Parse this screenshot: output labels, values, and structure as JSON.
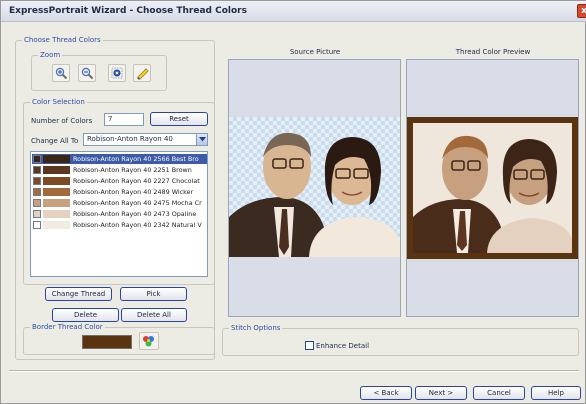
{
  "window": {
    "title": "ExpressPortrait Wizard - Choose Thread Colors",
    "close_glyph": "x"
  },
  "choose_group": {
    "label": "Choose Thread Colors"
  },
  "zoom": {
    "label": "Zoom",
    "buttons": [
      "zoom-in-icon",
      "zoom-out-icon",
      "zoom-fit-icon",
      "highlight-pen-icon"
    ]
  },
  "color_selection": {
    "label": "Color Selection",
    "number_of_colors_label": "Number of Colors",
    "number_of_colors_value": "7",
    "reset_label": "Reset",
    "change_all_label": "Change All To",
    "change_all_value": "Robison-Anton Rayon 40",
    "threads": [
      {
        "name": "Robison-Anton Rayon 40 2566 Best Bro",
        "color": "#3c2417"
      },
      {
        "name": "Robison-Anton Rayon 40 2251 Brown",
        "color": "#5c3620"
      },
      {
        "name": "Robison-Anton Rayon 40 2227 Chocolat",
        "color": "#7d4a26"
      },
      {
        "name": "Robison-Anton Rayon 40 2489 Wicker",
        "color": "#a2693a"
      },
      {
        "name": "Robison-Anton Rayon 40 2475 Mocha Cr",
        "color": "#c6a07f"
      },
      {
        "name": "Robison-Anton Rayon 40 2473 Opaline",
        "color": "#e4d1c0"
      },
      {
        "name": "Robison-Anton Rayon 40 2342 Natural V",
        "color": "#f2ebe2"
      }
    ]
  },
  "buttons": {
    "change_thread": "Change Thread",
    "pick": "Pick",
    "delete": "Delete",
    "delete_all": "Delete All"
  },
  "border_thread": {
    "label": "Border Thread Color",
    "color": "#5a3311"
  },
  "source_picture": {
    "label": "Source Picture"
  },
  "thread_preview": {
    "label": "Thread Color Preview"
  },
  "stitch_options": {
    "label": "Stitch Options",
    "enhance_detail_label": "Enhance Detail",
    "enhance_detail_checked": false
  },
  "footer": {
    "back": "< Back",
    "next": "Next >",
    "cancel": "Cancel",
    "help": "Help"
  }
}
